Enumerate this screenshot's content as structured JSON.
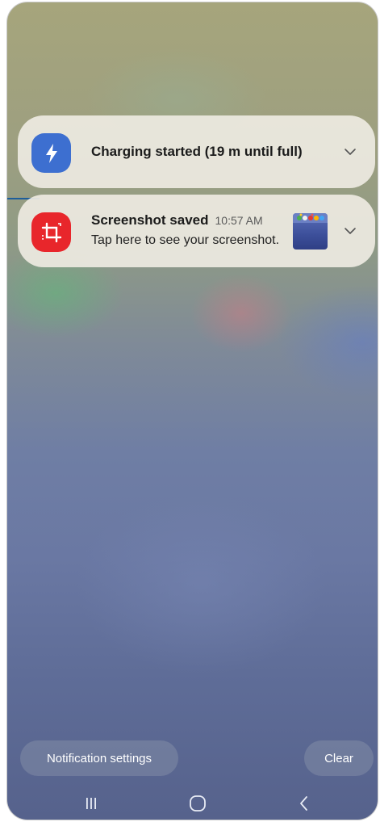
{
  "notifications": [
    {
      "app_icon": "lightning-bolt-icon",
      "icon_color": "#3d6fd0",
      "title": "Charging started (19 m until full)",
      "expand_icon": "chevron-down-icon"
    },
    {
      "app_icon": "screenshot-crop-icon",
      "icon_color": "#e8262b",
      "title": "Screenshot saved",
      "time": "10:57 AM",
      "body": "Tap here to see your screenshot.",
      "thumbnail": "screenshot-thumbnail",
      "expand_icon": "chevron-down-icon"
    }
  ],
  "footer": {
    "settings_label": "Notification settings",
    "clear_label": "Clear"
  },
  "navbar": {
    "recents_icon": "recents-icon",
    "home_icon": "home-icon",
    "back_icon": "back-icon"
  }
}
